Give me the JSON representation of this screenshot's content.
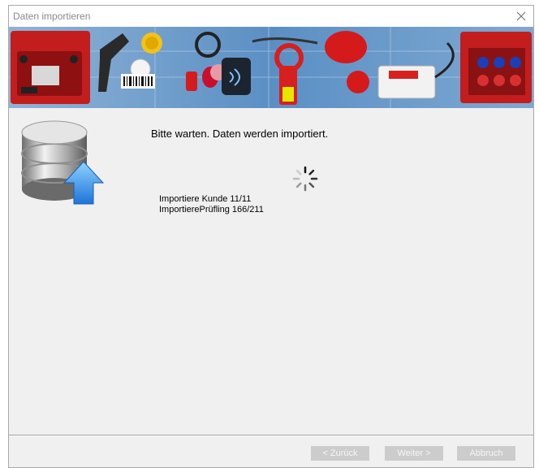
{
  "window": {
    "title": "Daten importieren"
  },
  "icons": {
    "close": "close-icon",
    "database": "database-upload-icon",
    "spinner": "loading-spinner-icon"
  },
  "banner": {
    "description_icons": [
      "red-test-case",
      "barcode-scanner",
      "barcode-label",
      "rfid-tag",
      "rfid-reader",
      "clamp-meter",
      "cee-plug",
      "adapter-box",
      "socket-test-case"
    ]
  },
  "status": {
    "title": "Bitte warten. Daten werden importiert.",
    "line1": "Importiere Kunde 11/11",
    "line2": "ImportierePrüfling 166/211"
  },
  "buttons": {
    "back": "< Zurück",
    "next": "Weiter >",
    "cancel": "Abbruch"
  },
  "colors": {
    "banner_blue": "#4a7fb5",
    "accent_red": "#d42020",
    "button_disabled": "#cccccc"
  }
}
